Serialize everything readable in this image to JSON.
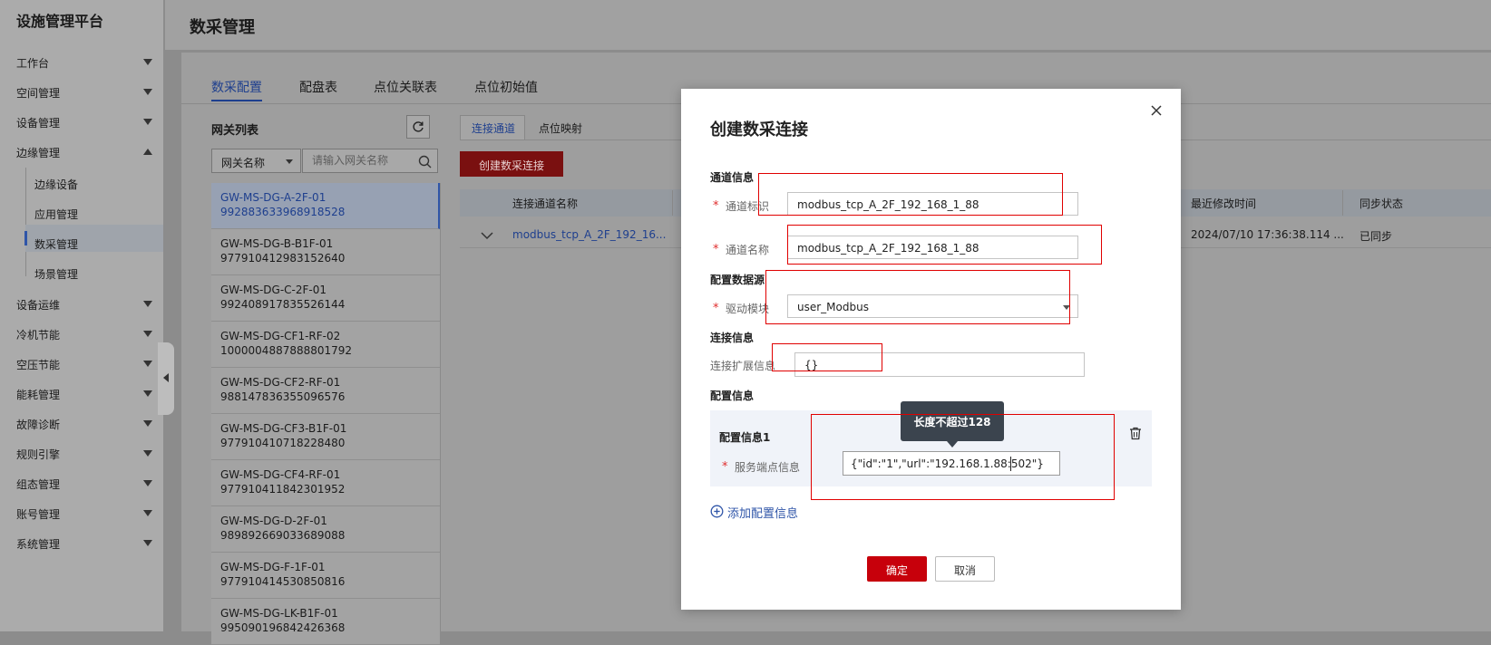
{
  "sidebar": {
    "brand": "设施管理平台",
    "menu": [
      {
        "label": "工作台",
        "expanded": false
      },
      {
        "label": "空间管理",
        "expanded": false
      },
      {
        "label": "设备管理",
        "expanded": false
      },
      {
        "label": "边缘管理",
        "expanded": true
      },
      {
        "label": "设备运维",
        "expanded": false
      },
      {
        "label": "冷机节能",
        "expanded": false
      },
      {
        "label": "空压节能",
        "expanded": false
      },
      {
        "label": "能耗管理",
        "expanded": false
      },
      {
        "label": "故障诊断",
        "expanded": false
      },
      {
        "label": "规则引擎",
        "expanded": false
      },
      {
        "label": "组态管理",
        "expanded": false
      },
      {
        "label": "账号管理",
        "expanded": false
      },
      {
        "label": "系统管理",
        "expanded": false
      }
    ],
    "submenu": [
      "边缘设备",
      "应用管理",
      "数采管理",
      "场景管理"
    ],
    "active_submenu": "数采管理"
  },
  "page": {
    "title": "数采管理",
    "tabs": [
      "数采配置",
      "配盘表",
      "点位关联表",
      "点位初始值"
    ],
    "active_tab": "数采配置"
  },
  "gateway": {
    "title": "网关列表",
    "filter_field": "网关名称",
    "search_placeholder": "请输入网关名称",
    "items": [
      {
        "name": "GW-MS-DG-A-2F-01",
        "id": "992883633968918528"
      },
      {
        "name": "GW-MS-DG-B-B1F-01",
        "id": "977910412983152640"
      },
      {
        "name": "GW-MS-DG-C-2F-01",
        "id": "992408917835526144"
      },
      {
        "name": "GW-MS-DG-CF1-RF-02",
        "id": "1000004887888801792"
      },
      {
        "name": "GW-MS-DG-CF2-RF-01",
        "id": "988147836355096576"
      },
      {
        "name": "GW-MS-DG-CF3-B1F-01",
        "id": "977910410718228480"
      },
      {
        "name": "GW-MS-DG-CF4-RF-01",
        "id": "977910411842301952"
      },
      {
        "name": "GW-MS-DG-D-2F-01",
        "id": "989892669033689088"
      },
      {
        "name": "GW-MS-DG-F-1F-01",
        "id": "977910414530850816"
      },
      {
        "name": "GW-MS-DG-LK-B1F-01",
        "id": "995090196842426368"
      }
    ]
  },
  "right": {
    "subtabs": [
      "连接通道",
      "点位映射"
    ],
    "create_button": "创建数采连接",
    "columns": {
      "name": "连接通道名称",
      "modified": "最近修改时间",
      "sync": "同步状态"
    },
    "row": {
      "name": "modbus_tcp_A_2F_192_16...",
      "modified": "2024/07/10 17:36:38.114 ...",
      "sync": "已同步"
    }
  },
  "modal": {
    "title": "创建数采连接",
    "section_channel": "通道信息",
    "channel_id_label": "通道标识",
    "channel_id_value": "modbus_tcp_A_2F_192_168_1_88",
    "channel_name_label": "通道名称",
    "channel_name_value": "modbus_tcp_A_2F_192_168_1_88",
    "section_source": "配置数据源",
    "driver_label": "驱动模块",
    "driver_value": "user_Modbus",
    "section_conn": "连接信息",
    "conn_ext_label": "连接扩展信息",
    "conn_ext_value": "{}",
    "section_config": "配置信息",
    "config_item_title": "配置信息1",
    "endpoint_label": "服务端点信息",
    "endpoint_value": "{\"id\":\"1\",\"url\":\"192.168.1.88:502\"}",
    "tooltip": "长度不超过128",
    "add_config": "添加配置信息",
    "ok": "确定",
    "cancel": "取消",
    "required_mark": "*"
  }
}
